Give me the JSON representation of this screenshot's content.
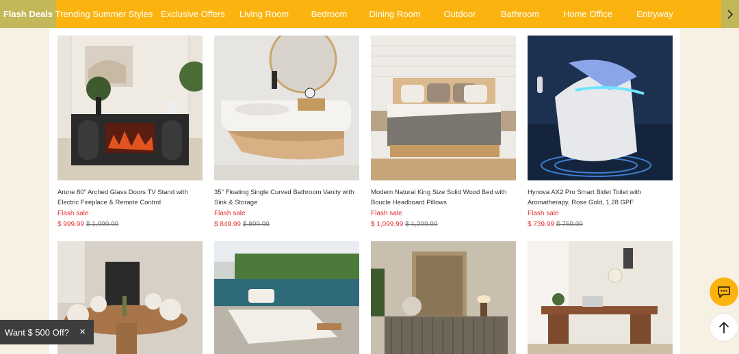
{
  "nav": {
    "tabs": [
      {
        "label": "Flash Deals",
        "active": true
      },
      {
        "label": "Trending Summer Styles",
        "active": false
      },
      {
        "label": "Exclusive Offers",
        "active": false
      },
      {
        "label": "Living Room",
        "active": false
      },
      {
        "label": "Bedroom",
        "active": false
      },
      {
        "label": "Dining Room",
        "active": false
      },
      {
        "label": "Outdoor",
        "active": false
      },
      {
        "label": "Bathroom",
        "active": false
      },
      {
        "label": "Home Office",
        "active": false
      },
      {
        "label": "Entryway",
        "active": false
      }
    ],
    "next_icon": "chevron-right-icon"
  },
  "products": [
    {
      "title": "Arune 80\" Arched Glass Doors TV Stand with Electric Fireplace & Remote Control",
      "badge": "Flash sale",
      "price": "$ 999.99",
      "original_price": "$ 1,099.99"
    },
    {
      "title": "35\" Floating Single Curved Bathroom Vanity with Sink & Storage",
      "badge": "Flash sale",
      "price": "$ 849.99",
      "original_price": "$ 899.99"
    },
    {
      "title": "Modern Natural King Size Solid Wood Bed with Boucle Headboard Pillows",
      "badge": "Flash sale",
      "price": "$ 1,099.99",
      "original_price": "$ 1,299.99"
    },
    {
      "title": "Hynova AX2 Pro Smart Bidet Toilet with Aromatherapy, Rose Gold, 1.28 GPF",
      "badge": "Flash sale",
      "price": "$ 739.99",
      "original_price": "$ 759.99"
    },
    {
      "title": "",
      "badge": "",
      "price": "",
      "original_price": ""
    },
    {
      "title": "",
      "badge": "",
      "price": "",
      "original_price": ""
    },
    {
      "title": "",
      "badge": "",
      "price": "",
      "original_price": ""
    },
    {
      "title": "",
      "badge": "",
      "price": "",
      "original_price": ""
    }
  ],
  "promo": {
    "label": "Want $ 500 Off?",
    "close": "×"
  },
  "floating": {
    "chat_icon": "chat-icon",
    "top_icon": "arrow-up-icon"
  },
  "colors": {
    "accent": "#fbb40f",
    "active_tab": "#c2b759",
    "sale": "#e0302f",
    "page_bg": "#f7f1e3"
  }
}
